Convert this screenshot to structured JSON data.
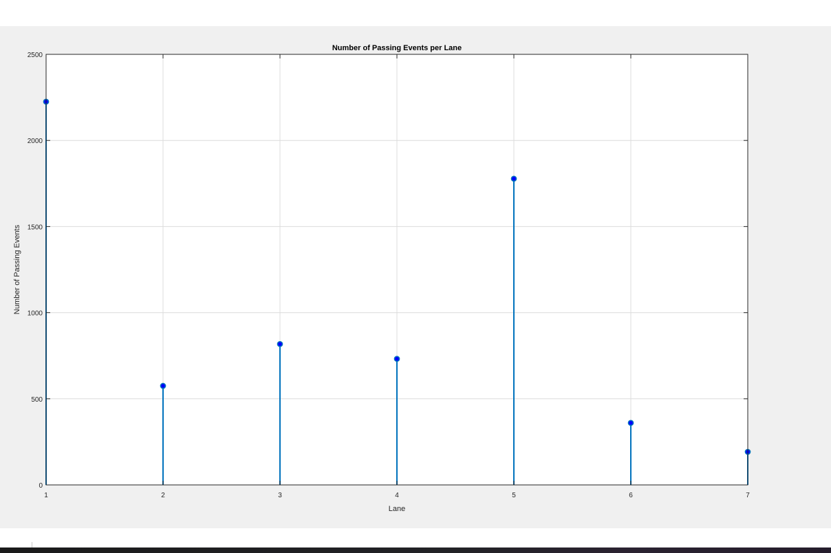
{
  "chart_data": {
    "type": "stem",
    "title": "Number of Passing Events per Lane",
    "xlabel": "Lane",
    "ylabel": "Number of Passing Events",
    "x": [
      1,
      2,
      3,
      4,
      5,
      6,
      7
    ],
    "values": [
      2225,
      575,
      818,
      732,
      1778,
      360,
      192
    ],
    "xlim": [
      1,
      7
    ],
    "ylim": [
      0,
      2500
    ],
    "xticks": [
      "1",
      "2",
      "3",
      "4",
      "5",
      "6",
      "7"
    ],
    "yticks": [
      0,
      500,
      1000,
      1500,
      2000,
      2500
    ],
    "ytick_labels": [
      "0",
      "500",
      "1000",
      "1500",
      "2000",
      "2500"
    ],
    "grid": true,
    "colors": {
      "stem": "#0072bd",
      "marker": "#0000ff",
      "grid": "#dcdcdc"
    }
  }
}
